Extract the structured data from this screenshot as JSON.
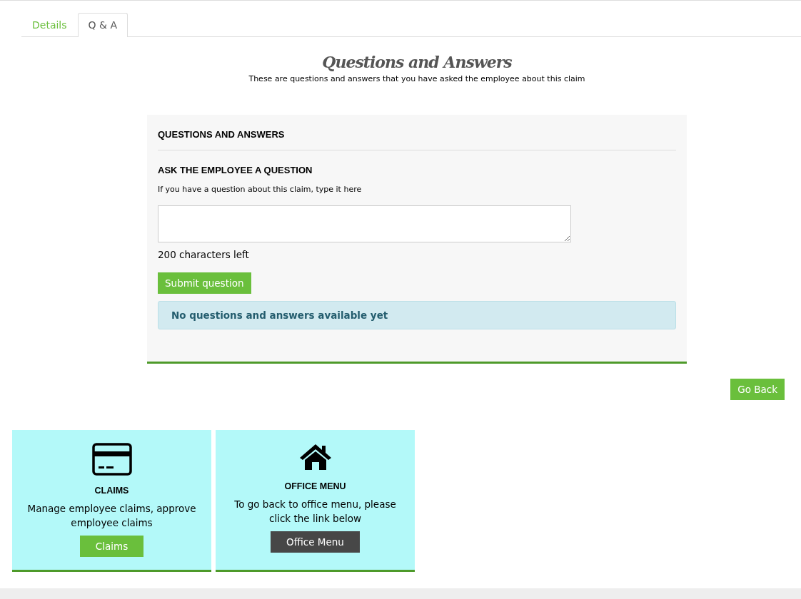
{
  "tabs": [
    {
      "label": "Details",
      "selected": false
    },
    {
      "label": "Q & A",
      "selected": true
    }
  ],
  "heading": {
    "title": "Questions and Answers",
    "subtitle": "These are questions and answers that you have asked the employee about this claim"
  },
  "panel": {
    "title": "QUESTIONS AND ANSWERS",
    "ask_title": "ASK THE EMPLOYEE A QUESTION",
    "hint": "If you have a question about this claim, type it here",
    "chars_left": "200 characters left",
    "submit": "Submit question",
    "empty_message": "No questions and answers available yet"
  },
  "go_back": "Go Back",
  "cards": [
    {
      "kind": "claims",
      "title": "CLAIMS",
      "text": "Manage employee claims, approve employee claims",
      "button": "Claims"
    },
    {
      "kind": "office",
      "title": "OFFICE MENU",
      "text": "To go back to office menu, please click the link below",
      "button": "Office Menu"
    }
  ]
}
